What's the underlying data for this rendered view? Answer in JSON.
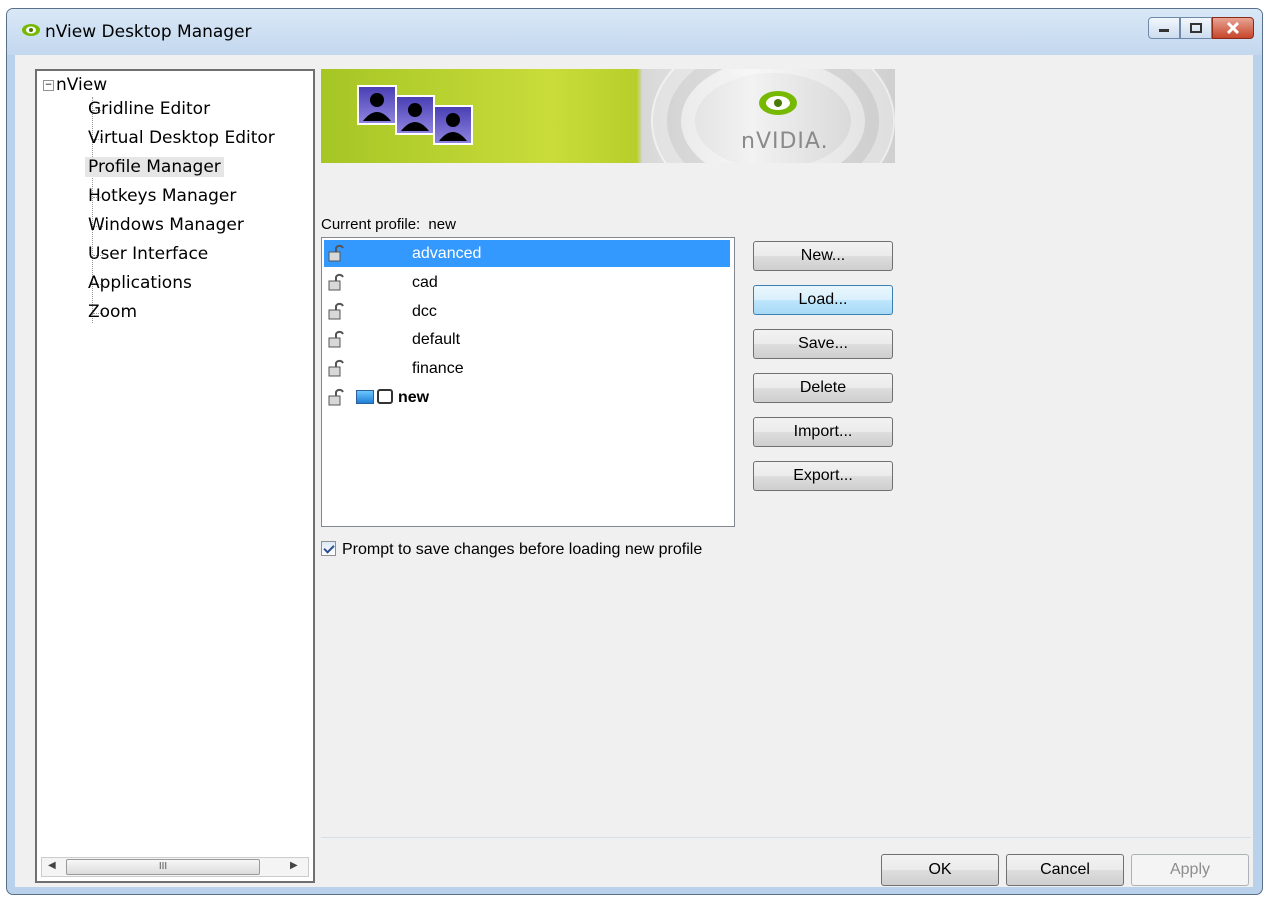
{
  "window": {
    "title": "nView Desktop Manager",
    "icon": "nvidia-app-icon",
    "caption_buttons": [
      "minimize-icon",
      "maximize-icon",
      "close-icon"
    ]
  },
  "tree": {
    "root": {
      "label": "nView",
      "expander": "⊟"
    },
    "items": [
      {
        "label": "Gridline Editor",
        "selected": false
      },
      {
        "label": "Virtual Desktop Editor",
        "selected": false
      },
      {
        "label": "Profile Manager",
        "selected": true
      },
      {
        "label": "Hotkeys Manager",
        "selected": false
      },
      {
        "label": "Windows Manager",
        "selected": false
      },
      {
        "label": "User Interface",
        "selected": false
      },
      {
        "label": "Applications",
        "selected": false
      },
      {
        "label": "Zoom",
        "selected": false
      }
    ],
    "scroll_grip": "III"
  },
  "banner": {
    "brand_text": "nVIDIA."
  },
  "profile": {
    "current_label": "Current profile:",
    "current_value": "new"
  },
  "profiles": [
    {
      "name": "advanced",
      "selected": true,
      "bold": false
    },
    {
      "name": "cad",
      "selected": false,
      "bold": false
    },
    {
      "name": "dcc",
      "selected": false,
      "bold": false
    },
    {
      "name": "default",
      "selected": false,
      "bold": false
    },
    {
      "name": "finance",
      "selected": false,
      "bold": false
    },
    {
      "name": "new",
      "selected": false,
      "bold": true
    }
  ],
  "buttons": {
    "new": "New...",
    "load": "Load...",
    "save": "Save...",
    "delete": "Delete",
    "import": "Import...",
    "export": "Export..."
  },
  "checkbox": {
    "label": "Prompt to save changes before loading new profile",
    "checked": true
  },
  "footer": {
    "ok": "OK",
    "cancel": "Cancel",
    "apply": "Apply"
  }
}
